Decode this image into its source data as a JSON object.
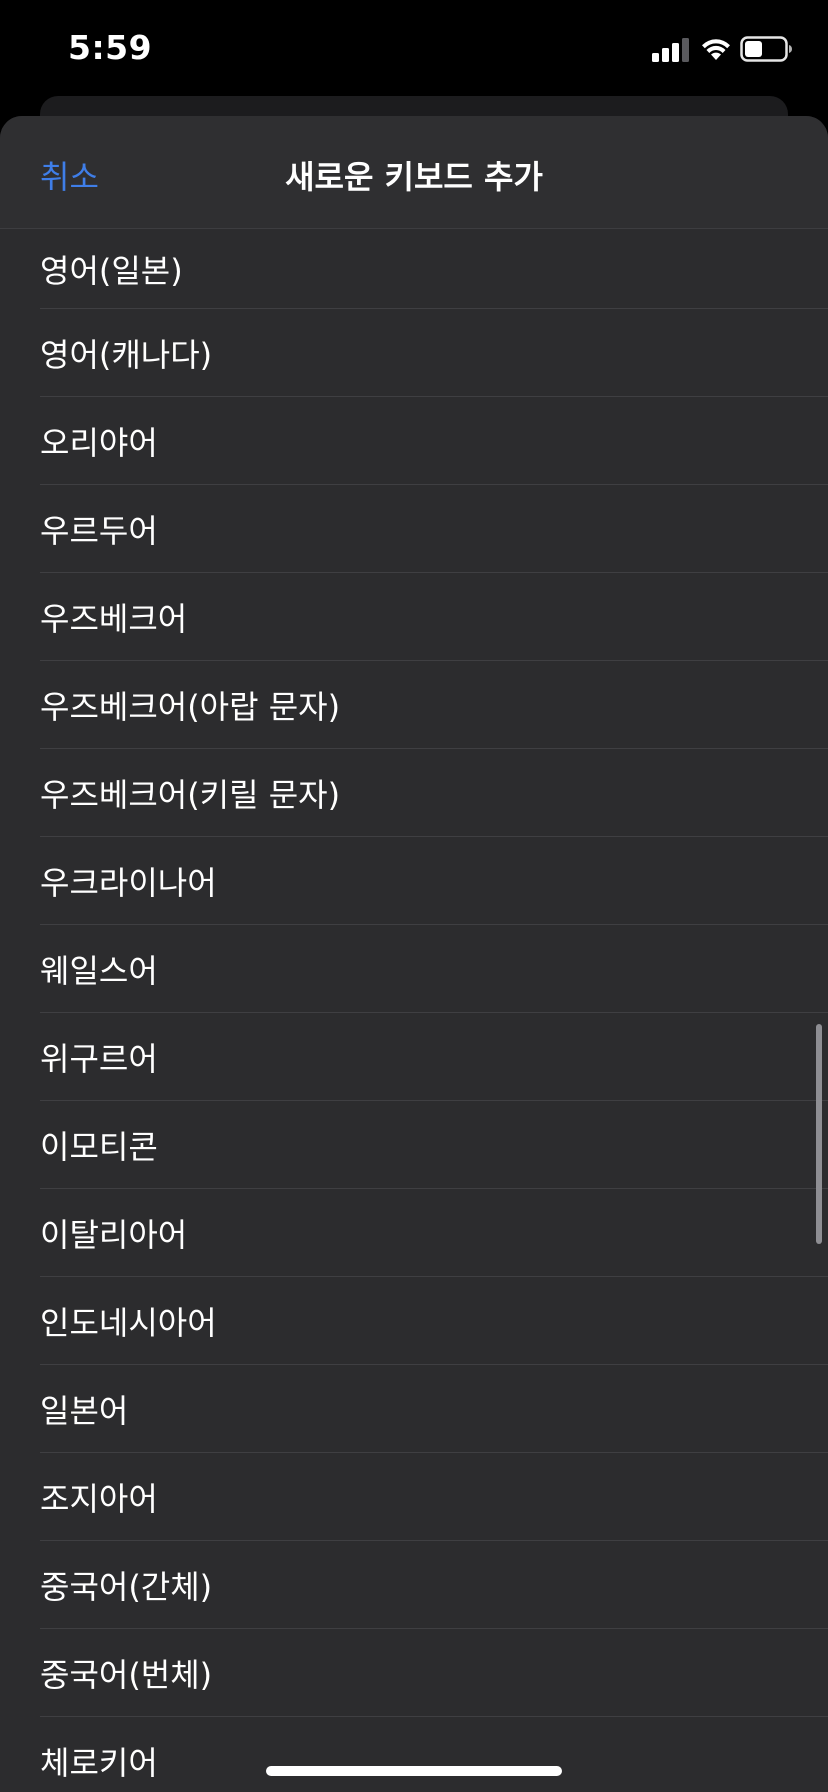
{
  "status_bar": {
    "time": "5:59"
  },
  "nav": {
    "cancel_label": "취소",
    "title": "새로운 키보드 추가"
  },
  "keyboards": [
    "영어(일본)",
    "영어(캐나다)",
    "오리야어",
    "우르두어",
    "우즈베크어",
    "우즈베크어(아랍 문자)",
    "우즈베크어(키릴 문자)",
    "우크라이나어",
    "웨일스어",
    "위구르어",
    "이모티콘",
    "이탈리아어",
    "인도네시아어",
    "일본어",
    "조지아어",
    "중국어(간체)",
    "중국어(번체)",
    "체로키어"
  ],
  "colors": {
    "accent": "#3f7ee8",
    "sheet_background": "#2c2c2e",
    "text": "#ffffff"
  }
}
